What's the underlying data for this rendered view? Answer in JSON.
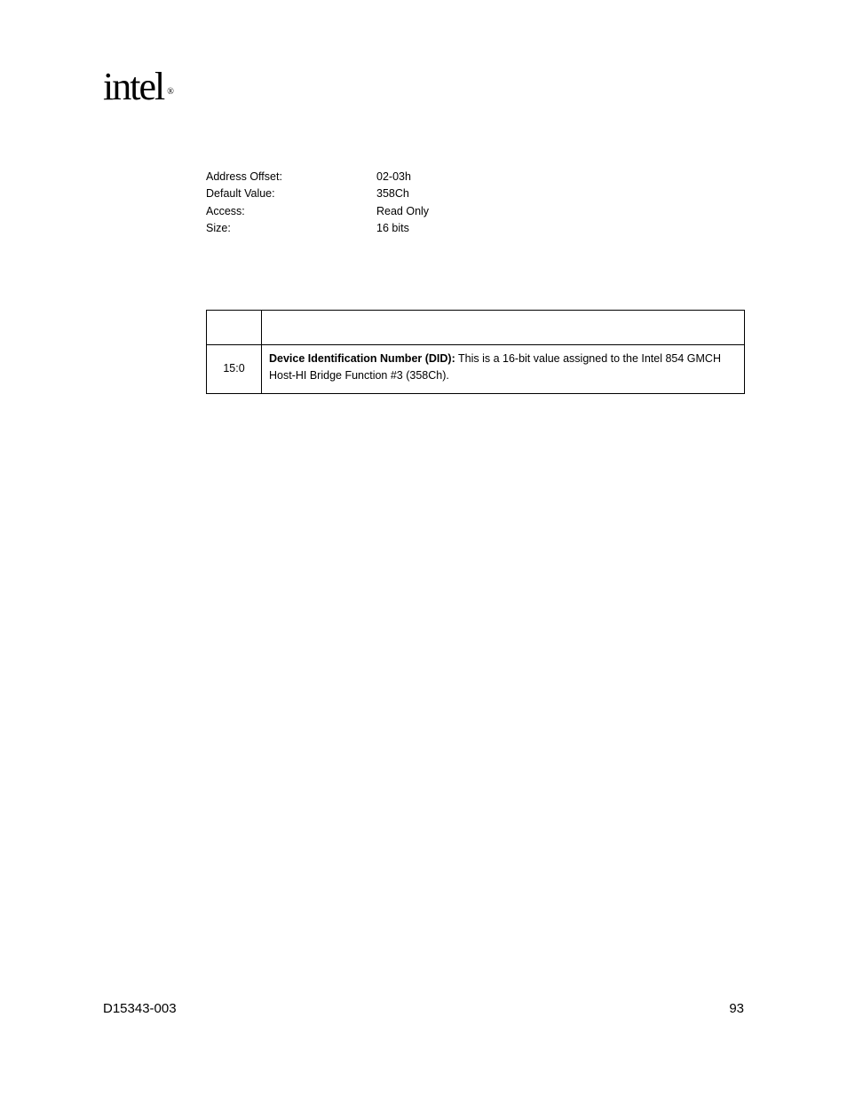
{
  "logo": {
    "text": "intel",
    "reg": "®"
  },
  "props": [
    {
      "label": "Address Offset:",
      "value": "02-03h"
    },
    {
      "label": "Default Value:",
      "value": "358Ch"
    },
    {
      "label": "Access:",
      "value": "Read Only"
    },
    {
      "label": "Size:",
      "value": "16 bits"
    }
  ],
  "table": {
    "header": {
      "bit": "",
      "description": ""
    },
    "rows": [
      {
        "bit": "15:0",
        "desc_bold": "Device Identification Number (DID):",
        "desc_rest": " This is a 16-bit value assigned to the Intel 854 GMCH Host-HI Bridge Function #3 (358Ch)."
      }
    ]
  },
  "footer": {
    "doc": "D15343-003",
    "page": "93"
  }
}
